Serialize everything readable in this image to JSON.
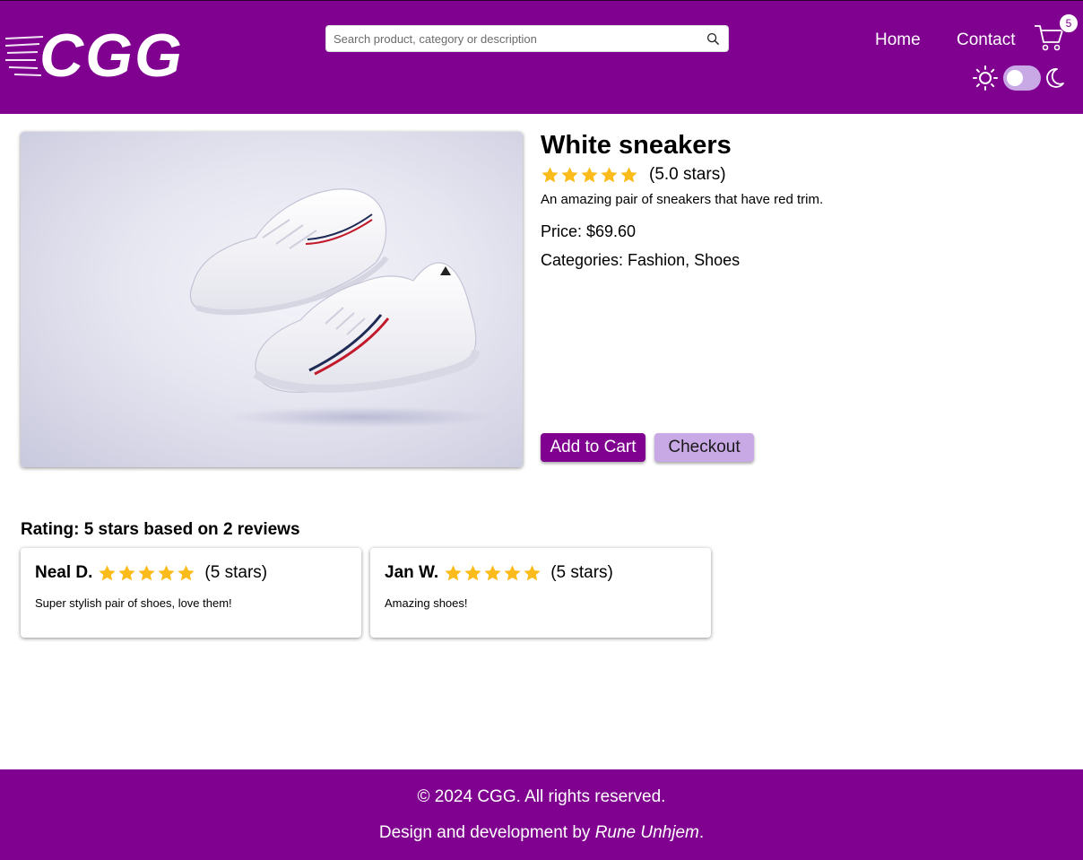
{
  "header": {
    "logo_text": "CGG",
    "search": {
      "placeholder": "Search product, category or description"
    },
    "nav": [
      {
        "label": "Home"
      },
      {
        "label": "Contact"
      }
    ],
    "cart_count": "5",
    "theme": {
      "mode": "light"
    }
  },
  "product": {
    "title": "White sneakers",
    "rating_value": 5,
    "rating_text": "(5.0 stars)",
    "description": "An amazing pair of sneakers that have red trim.",
    "price": "Price: $69.60",
    "categories": "Categories: Fashion, Shoes",
    "buttons": {
      "add_to_cart": "Add to Cart",
      "checkout": "Checkout"
    }
  },
  "reviews": {
    "heading": "Rating: 5 stars based on 2 reviews",
    "items": [
      {
        "name": "Neal D.",
        "stars": 5,
        "stars_text": "(5 stars)",
        "text": "Super stylish pair of shoes, love them!"
      },
      {
        "name": "Jan W.",
        "stars": 5,
        "stars_text": "(5 stars)",
        "text": "Amazing shoes!"
      }
    ]
  },
  "footer": {
    "copyright": "© 2024 CGG. All rights reserved.",
    "credit_prefix": "Design and development by ",
    "credit_name": "Rune Unhjem",
    "credit_suffix": "."
  },
  "colors": {
    "brand": "#800090",
    "accent_light": "#c8a9e6",
    "star": "#fbbc1b"
  }
}
